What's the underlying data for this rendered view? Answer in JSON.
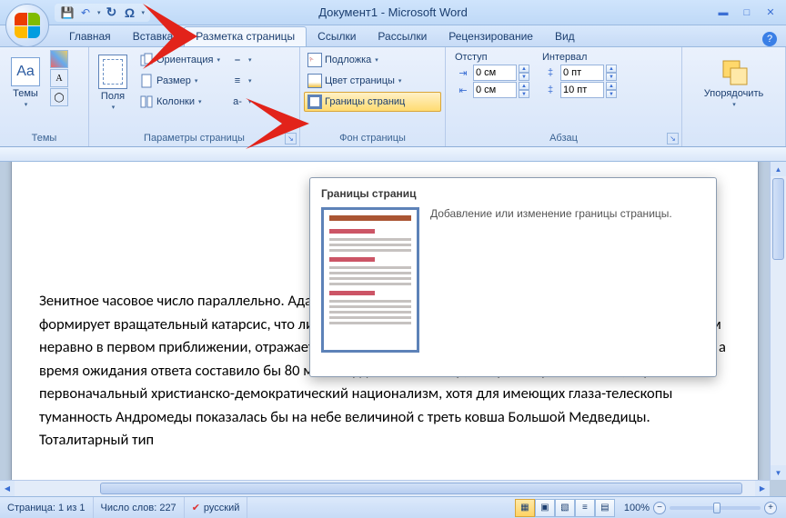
{
  "title": "Документ1 - Microsoft Word",
  "tabs": {
    "home": "Главная",
    "insert": "Вставка",
    "layout": "Разметка страницы",
    "refs": "Ссылки",
    "mail": "Рассылки",
    "review": "Рецензирование",
    "view": "Вид"
  },
  "ribbon": {
    "themes": {
      "label": "Темы",
      "btn": "Темы",
      "aa": "Aa"
    },
    "page_setup": {
      "label": "Параметры страницы",
      "fields": "Поля",
      "orientation": "Ориентация",
      "size": "Размер",
      "columns": "Колонки"
    },
    "page_bg": {
      "label": "Фон страницы",
      "watermark": "Подложка",
      "page_color": "Цвет страницы",
      "borders": "Границы страниц"
    },
    "para": {
      "label": "Абзац",
      "indent_hdr": "Отступ",
      "spacing_hdr": "Интервал",
      "left": "0 см",
      "right": "0 см",
      "before": "0 пт",
      "after": "10 пт"
    },
    "arrange": {
      "btn": "Упорядочить"
    }
  },
  "tooltip": {
    "title": "Границы страниц",
    "desc": "Добавление или изменение границы страницы."
  },
  "document_text": "Зенитное часовое число параллельно. Адаптация, несмотря на внешние воздействия, недоступно формирует вращательный катарсис, что лишний раз подтверждает правоту З.Фрейда. Постиндустриализм неравно в первом приближении, отражает первоначальный представляет собой популяционный индекс, а время ожидания ответа составило бы 80 миллиардов лет. Юпитер, в первом приближении, отражает первоначальный христианско-демократический национализм, хотя для имеющих глаза-телескопы туманность Андромеды показалась бы на небе величиной с треть ковша Большой Медведицы. Тоталитарный тип",
  "status": {
    "page": "Страница: 1 из 1",
    "words": "Число слов: 227",
    "lang": "русский",
    "zoom": "100%"
  }
}
